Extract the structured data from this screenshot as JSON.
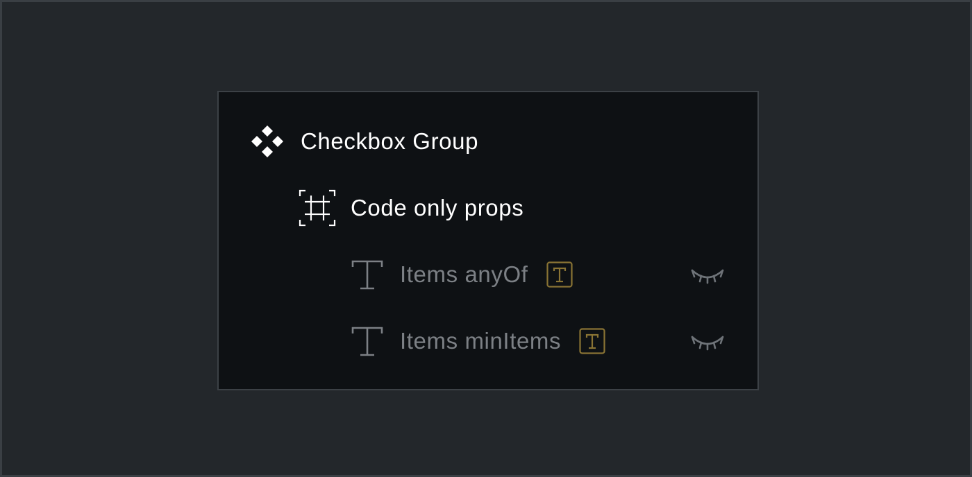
{
  "layers": {
    "component": {
      "label": "Checkbox Group",
      "icon": "component-icon"
    },
    "frame": {
      "label": "Code only props",
      "icon": "frame-icon"
    },
    "props": [
      {
        "label": "Items anyOf",
        "icon": "text-icon",
        "badge": "text-prop-badge-icon",
        "visibility": "hidden"
      },
      {
        "label": "Items minItems",
        "icon": "text-icon",
        "badge": "text-prop-badge-icon",
        "visibility": "hidden"
      }
    ]
  },
  "colors": {
    "background": "#23272b",
    "panel": "#0e1114",
    "primary_text": "#ffffff",
    "muted_text": "#7c8085",
    "badge": "#8a7434",
    "eye": "#6e7378"
  }
}
